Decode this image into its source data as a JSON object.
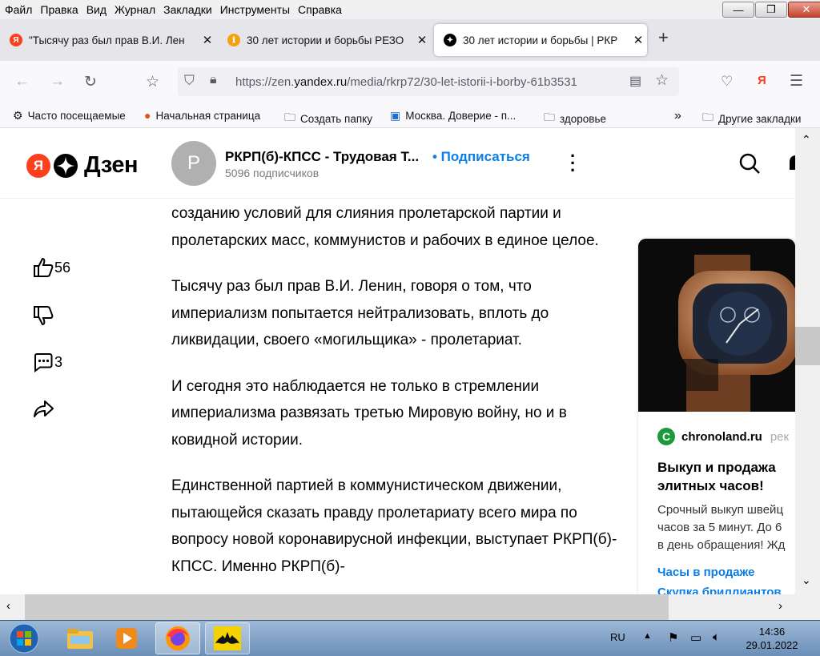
{
  "menu": [
    "Файл",
    "Правка",
    "Вид",
    "Журнал",
    "Закладки",
    "Инструменты",
    "Справка"
  ],
  "window_controls": {
    "minimize": "—",
    "restore": "❐",
    "close": "✕"
  },
  "tabs": [
    {
      "title": "\"Тысячу раз был прав В.И. Лен",
      "favicon": "Я",
      "color": "#fc3f1d"
    },
    {
      "title": "30 лет истории и борьбы РЕЗО",
      "favicon": "ℹ",
      "color": "#f6a10c"
    },
    {
      "title": "30 лет истории и борьбы | РКР",
      "favicon": "✦",
      "color": "#000000"
    }
  ],
  "url": {
    "prefix": "https://zen.",
    "domain": "yandex.ru",
    "path": "/media/rkrp72/30-let-istorii-i-borby-61b3531"
  },
  "bookmarks": [
    {
      "label": "Часто посещаемые",
      "icon": "gear-icon"
    },
    {
      "label": "Начальная страница",
      "icon": "firefox-icon"
    },
    {
      "label": "Создать папку",
      "icon": "folder-icon"
    },
    {
      "label": "Москва. Доверие - п...",
      "icon": "monitor-icon"
    },
    {
      "label": "здоровье",
      "icon": "folder-icon"
    },
    {
      "label": "Другие закладки",
      "icon": "folder-icon"
    }
  ],
  "header": {
    "logo_ya": "Я",
    "logo_text": "Дзен",
    "avatar_letter": "P",
    "channel_name": "РКРП(б)-КПСС - Трудовая Т...",
    "subscribe": "• Подписаться",
    "subscribers": "5096 подписчиков"
  },
  "article": {
    "paragraphs": [
      "созданию условий для слияния пролетарской партии и пролетарских масс, коммунистов и рабочих в единое целое.",
      "Тысячу раз был прав В.И. Ленин, говоря о том, что империализм попытается нейтрализовать, вплоть до ликвидации, своего «могильщика» - пролетариат.",
      "И сегодня это наблюдается не только в стремлении империализма развязать третью Мировую войну, но и в ковидной истории.",
      "Единственной партией в коммунистическом движении, пытающейся сказать правду пролетариату всего мира по вопросу новой коронавирусной инфекции, выступает РКРП(б)-КПСС. Именно РКРП(б)-"
    ]
  },
  "actions": {
    "likes": "56",
    "comments": "3"
  },
  "ad": {
    "site_letter": "C",
    "site": "chronoland.ru",
    "site_extra": "рек",
    "title": "Выкуп и продажа элитных часов!",
    "desc_lines": [
      "Срочный выкуп швейц",
      "часов за 5 минут. До 6",
      "в день обращения! Жд"
    ],
    "links": [
      "Часы в продаже",
      "Скупка бриллиантов"
    ]
  },
  "taskbar": {
    "lang": "RU",
    "time": "14:36",
    "date": "29.01.2022"
  }
}
